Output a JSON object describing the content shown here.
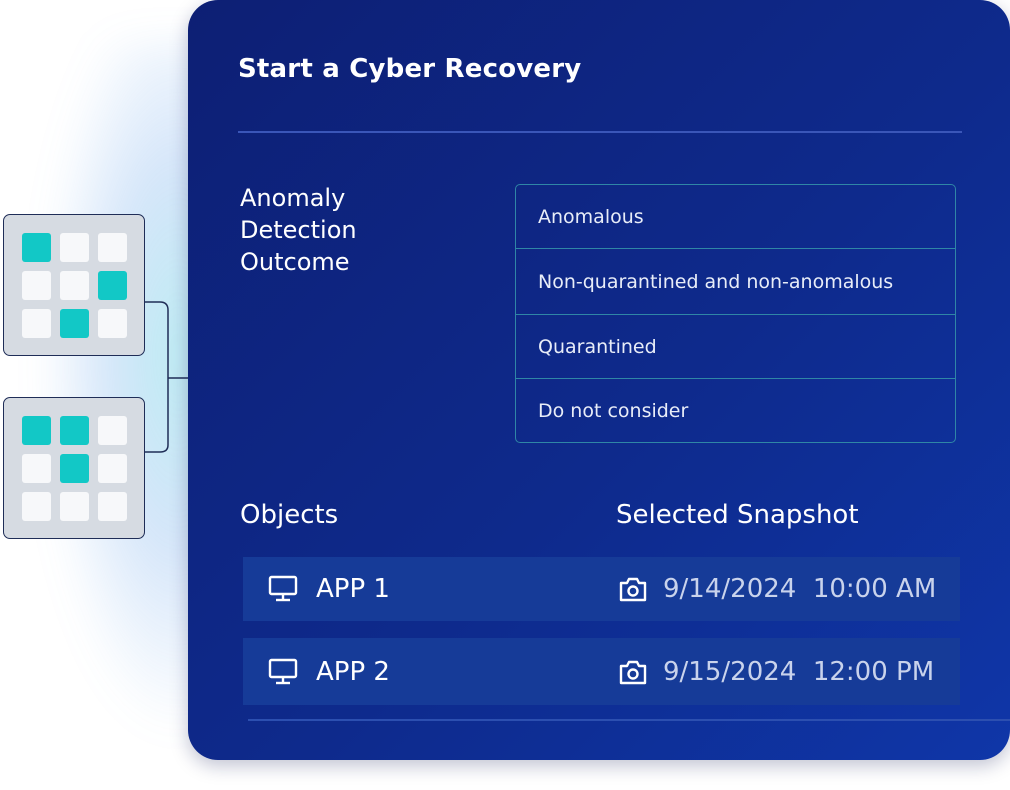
{
  "panel": {
    "title": "Start a Cyber Recovery",
    "detection_label": "Anomaly\nDetection\nOutcome",
    "options": [
      "Anomalous",
      "Non-quarantined and non-anomalous",
      "Quarantined",
      "Do not consider"
    ],
    "objects_header": "Objects",
    "snapshot_header": "Selected Snapshot",
    "rows": [
      {
        "app": "APP 1",
        "snapshot": "9/14/2024  10:00 AM"
      },
      {
        "app": "APP 2",
        "snapshot": "9/15/2024  12:00 PM"
      }
    ]
  },
  "colors": {
    "panel_start": "#0d1f74",
    "panel_end": "#0f36a8",
    "accent_teal": "#12c8c6",
    "row_bg": "#163b98"
  },
  "icons": {
    "object": "monitor-icon",
    "snapshot": "camera-icon"
  }
}
